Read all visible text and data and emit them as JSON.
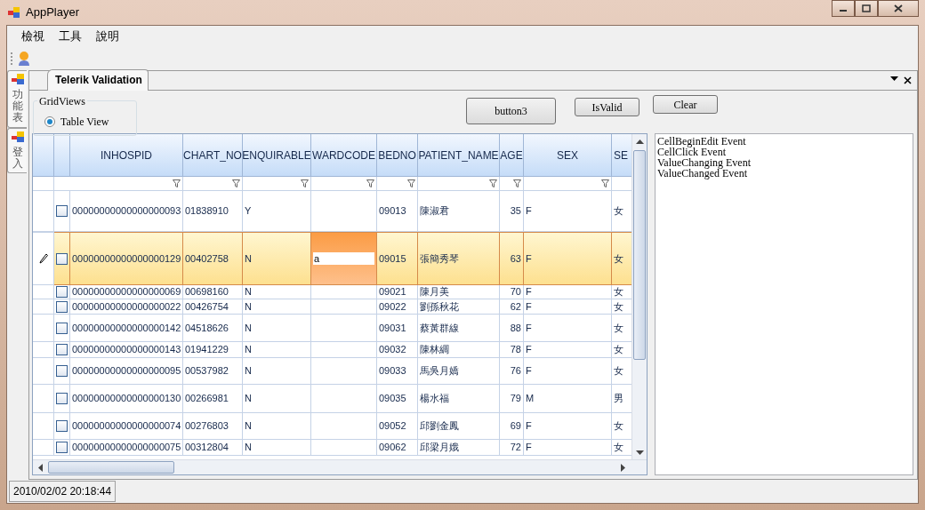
{
  "window": {
    "title": "AppPlayer"
  },
  "menu": [
    {
      "label": "檢視"
    },
    {
      "label": "工具"
    },
    {
      "label": "說明"
    }
  ],
  "side_tabs": [
    {
      "label": "功能表"
    },
    {
      "label": "登入"
    }
  ],
  "document_tab": {
    "label": "Telerik Validation"
  },
  "grid_views": {
    "title": "GridViews",
    "options": [
      {
        "label": "Table View",
        "selected": true
      }
    ]
  },
  "buttons": [
    {
      "label": "button3"
    },
    {
      "label": "IsValid"
    },
    {
      "label": "Clear"
    }
  ],
  "grid": {
    "columns": [
      {
        "label": "INHOSPID",
        "kind": "text"
      },
      {
        "label": "CHART_NO",
        "kind": "text"
      },
      {
        "label": "ENQUIRABLE",
        "kind": "text"
      },
      {
        "label": "WARDCODE",
        "kind": "text"
      },
      {
        "label": "BEDNO",
        "kind": "text"
      },
      {
        "label": "PATIENT_NAME",
        "kind": "text"
      },
      {
        "label": "AGE",
        "kind": "number"
      },
      {
        "label": "SEX",
        "kind": "text"
      },
      {
        "label": "SE",
        "kind": "text"
      }
    ],
    "rows": [
      {
        "current": false,
        "checked": false,
        "cells": [
          "00000000000000000093",
          "01838910",
          "Y",
          "",
          "09013",
          "陳淑君",
          "35",
          "F",
          "女"
        ]
      },
      {
        "current": true,
        "checked": false,
        "cells": [
          "00000000000000000129",
          "00402758",
          "N",
          "a",
          "09015",
          "張簡秀琴",
          "63",
          "F",
          "女"
        ]
      },
      {
        "current": false,
        "checked": false,
        "cells": [
          "00000000000000000069",
          "00698160",
          "N",
          "",
          "09021",
          "陳月美",
          "70",
          "F",
          "女"
        ]
      },
      {
        "current": false,
        "checked": false,
        "cells": [
          "00000000000000000022",
          "00426754",
          "N",
          "",
          "09022",
          "劉孫秋花",
          "62",
          "F",
          "女"
        ]
      },
      {
        "current": false,
        "checked": false,
        "cells": [
          "00000000000000000142",
          "04518626",
          "N",
          "",
          "09031",
          "蔡黃群線",
          "88",
          "F",
          "女"
        ]
      },
      {
        "current": false,
        "checked": false,
        "cells": [
          "00000000000000000143",
          "01941229",
          "N",
          "",
          "09032",
          "陳林綢",
          "78",
          "F",
          "女"
        ]
      },
      {
        "current": false,
        "checked": false,
        "cells": [
          "00000000000000000095",
          "00537982",
          "N",
          "",
          "09033",
          "馬吳月嬌",
          "76",
          "F",
          "女"
        ]
      },
      {
        "current": false,
        "checked": false,
        "cells": [
          "00000000000000000130",
          "00266981",
          "N",
          "",
          "09035",
          "楊水福",
          "79",
          "M",
          "男"
        ]
      },
      {
        "current": false,
        "checked": false,
        "cells": [
          "00000000000000000074",
          "00276803",
          "N",
          "",
          "09052",
          "邱劉金鳳",
          "69",
          "F",
          "女"
        ]
      },
      {
        "current": false,
        "checked": false,
        "cells": [
          "00000000000000000075",
          "00312804",
          "N",
          "",
          "09062",
          "邱梁月娥",
          "72",
          "F",
          "女"
        ]
      }
    ]
  },
  "event_log": [
    "CellBeginEdit Event",
    "CellClick Event",
    "ValueChanging Event",
    "ValueChanged Event"
  ],
  "status_bar": {
    "text": "2010/02/02 20:18:44"
  }
}
